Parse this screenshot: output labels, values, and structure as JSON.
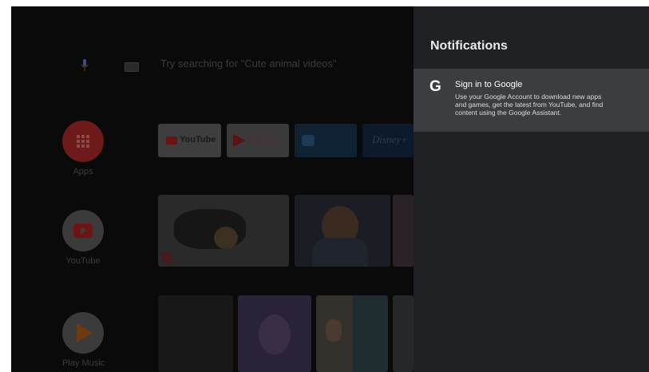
{
  "search": {
    "hint": "Try searching for \"Cute animal videos\""
  },
  "rail": [
    {
      "label": "Apps",
      "color": "#7a1b1b"
    },
    {
      "label": "YouTube",
      "color": "#7a1b1b"
    },
    {
      "label": "Play Music",
      "color": "#7a3d10"
    }
  ],
  "apps_row": [
    {
      "label": "YouTube"
    },
    {
      "label": "Google Play Movies & TV"
    },
    {
      "label": ""
    },
    {
      "label": "Disney+"
    }
  ],
  "notifications": {
    "title": "Notifications",
    "items": [
      {
        "icon": "G",
        "title": "Sign in to Google",
        "body": "Use your Google Account to download new apps and games, get the latest from YouTube, and find content using the Google Assistant."
      }
    ]
  }
}
